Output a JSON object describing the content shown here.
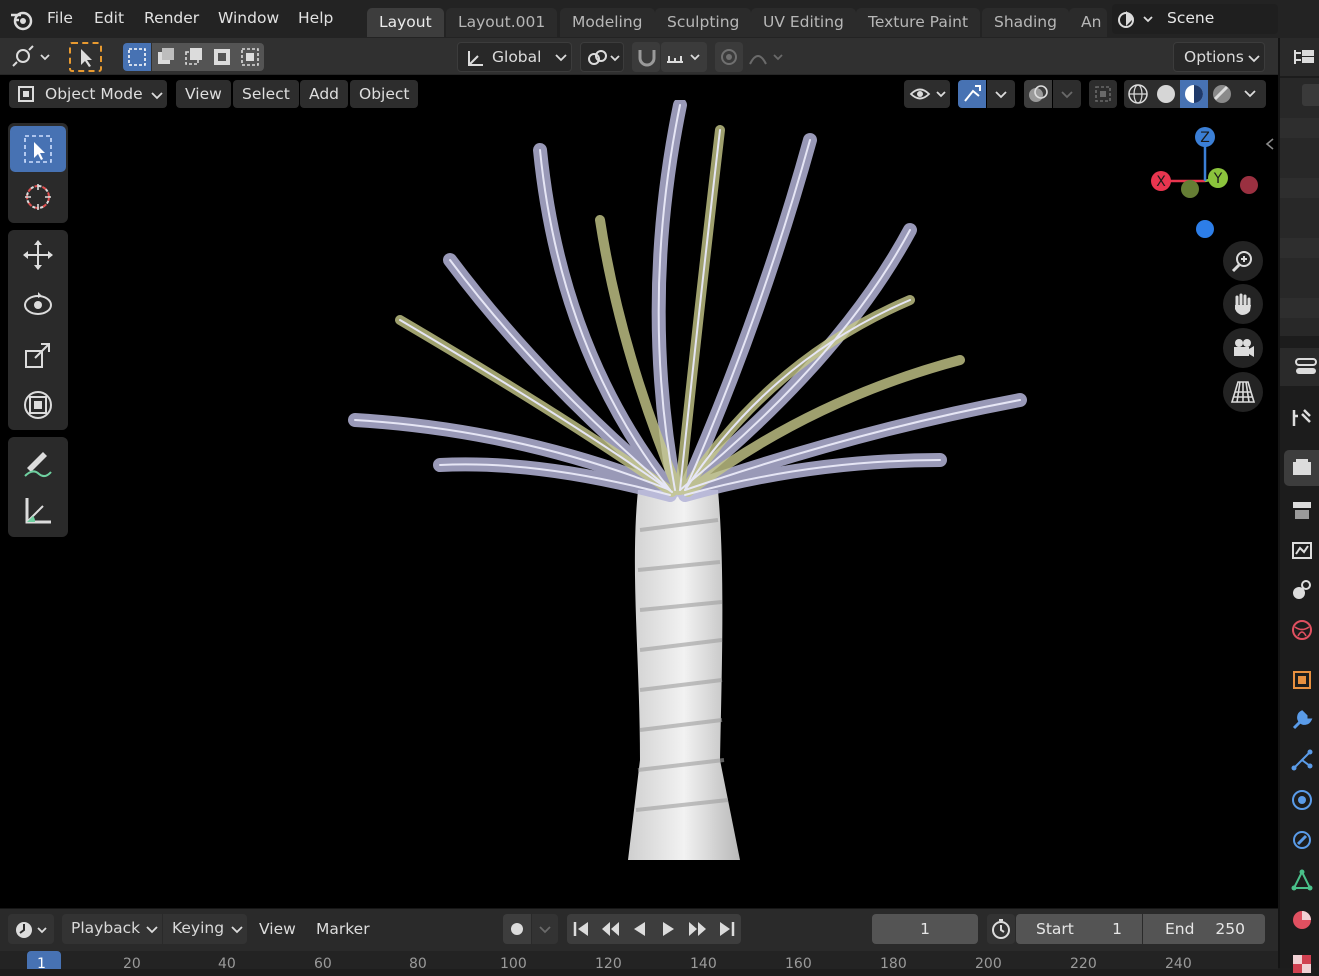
{
  "top_menu": {
    "items": [
      "File",
      "Edit",
      "Render",
      "Window",
      "Help"
    ]
  },
  "workspace_tabs": [
    "Layout",
    "Layout.001",
    "Modeling",
    "Sculpting",
    "UV Editing",
    "Texture Paint",
    "Shading",
    "An"
  ],
  "active_tab": "Layout",
  "scene_name": "Scene",
  "tool_header": {
    "transform_orientation": "Global",
    "options_label": "Options"
  },
  "viewport_header": {
    "mode": "Object Mode",
    "menus": [
      "View",
      "Select",
      "Add",
      "Object"
    ]
  },
  "gizmo": {
    "axes": {
      "z": "Z",
      "x": "X",
      "y": "Y"
    },
    "colors": {
      "x": "#e8354f",
      "y": "#8bc33c",
      "z": "#3b7fd6",
      "x_neg": "#9a3040",
      "y_neg": "#657d34",
      "z_neg": "#2d7ee8"
    }
  },
  "timeline": {
    "menus": [
      "Playback",
      "Keying",
      "View",
      "Marker"
    ],
    "current_frame": "1",
    "start_label": "Start",
    "start_value": "1",
    "end_label": "End",
    "end_value": "250",
    "ruler_marks": [
      "1",
      "20",
      "40",
      "60",
      "80",
      "100",
      "120",
      "140",
      "160",
      "180",
      "200",
      "220",
      "240"
    ]
  },
  "colors": {
    "accent": "#4772b3",
    "viewport_bg": "#000000"
  }
}
